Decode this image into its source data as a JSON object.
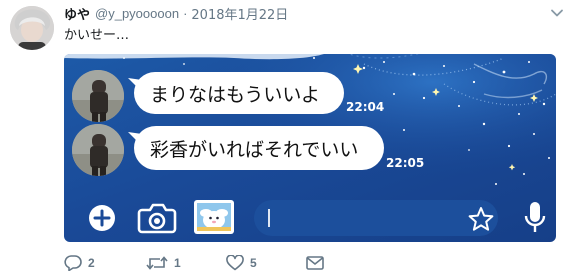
{
  "tweet": {
    "display_name": "ゆや",
    "handle": "@y_pyooooon",
    "separator": "·",
    "date": "2018年1月22日",
    "text": "かいせー…"
  },
  "chat": {
    "messages": [
      {
        "text": "まりなはもういいよ",
        "time": "22:04"
      },
      {
        "text": "彩香がいればそれでいい",
        "time": "22:05"
      }
    ],
    "input": {
      "value": ""
    }
  },
  "icons": {
    "chevron": "chevron-down-icon",
    "plus": "plus-circle-icon",
    "camera": "camera-icon",
    "gallery": "image-gallery-icon",
    "sticker": "star-sticker-icon",
    "mic": "microphone-icon",
    "reply": "reply-icon",
    "retweet": "retweet-icon",
    "like": "heart-icon",
    "dm": "envelope-icon"
  },
  "actions": {
    "reply_count": "2",
    "retweet_count": "1",
    "like_count": "5"
  },
  "colors": {
    "chat_background": "#1a4a98",
    "bubble": "#ffffff",
    "secondary_text": "#657786"
  }
}
